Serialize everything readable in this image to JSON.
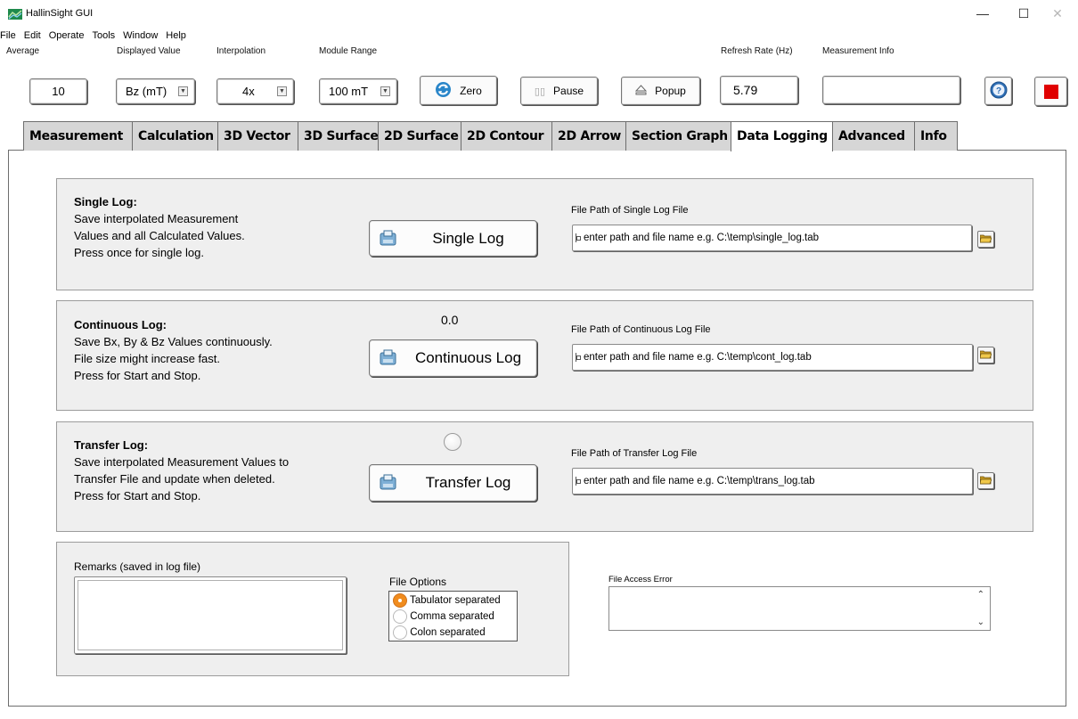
{
  "window": {
    "title": "HallinSight GUI",
    "controls": {
      "minimize": "—",
      "maximize": "☐",
      "close": "✕"
    }
  },
  "menu": [
    "File",
    "Edit",
    "Operate",
    "Tools",
    "Window",
    "Help"
  ],
  "toolbar": {
    "average": {
      "label": "Average",
      "value": "10"
    },
    "displayed_value": {
      "label": "Displayed Value",
      "value": "Bz (mT)"
    },
    "interpolation": {
      "label": "Interpolation",
      "value": "4x"
    },
    "module_range": {
      "label": "Module Range",
      "value": "100 mT"
    },
    "zero_button": "Zero",
    "pause_button": "Pause",
    "popup_button": "Popup",
    "refresh_rate": {
      "label": "Refresh Rate (Hz)",
      "value": "5.79"
    },
    "measurement_info": {
      "label": "Measurement Info",
      "value": ""
    }
  },
  "tabs": [
    "Measurement",
    "Calculation",
    "3D Vector",
    "3D Surface",
    "2D Surface",
    "2D Contour",
    "2D Arrow",
    "Section Graph",
    "Data Logging",
    "Advanced",
    "Info"
  ],
  "active_tab": "Data Logging",
  "single_log": {
    "title": "Single Log:",
    "desc": [
      "Save interpolated Measurement",
      "Values and all Calculated Values.",
      "Press once for single log."
    ],
    "button": "Single Log",
    "path_label": "File Path of Single Log File",
    "path_value": "enter path and file name e.g. C:\\temp\\single_log.tab"
  },
  "continuous_log": {
    "title": "Continuous Log:",
    "desc": [
      "Save Bx, By & Bz Values continuously.",
      "File size might increase fast.",
      "Press for Start and Stop."
    ],
    "counter": "0.0",
    "button": "Continuous Log",
    "path_label": "File Path of Continuous Log File",
    "path_value": "enter path and file name e.g. C:\\temp\\cont_log.tab"
  },
  "transfer_log": {
    "title": "Transfer Log:",
    "desc": [
      "Save interpolated Measurement Values to",
      "Transfer File and update when deleted.",
      "Press for Start and Stop."
    ],
    "button": "Transfer Log",
    "path_label": "File Path of Transfer Log File",
    "path_value": "enter path and file name e.g. C:\\temp\\trans_log.tab"
  },
  "remarks": {
    "label": "Remarks (saved in log file)",
    "value": ""
  },
  "file_options": {
    "label": "File Options",
    "options": [
      "Tabulator separated",
      "Comma separated",
      "Colon separated"
    ],
    "selected": "Tabulator separated"
  },
  "file_access_error": {
    "label": "File Access Error",
    "value": ""
  },
  "colors": {
    "radio_selected": "#f08c1e",
    "stop_button": "#e00000",
    "help_button": "#2f6fb5"
  }
}
